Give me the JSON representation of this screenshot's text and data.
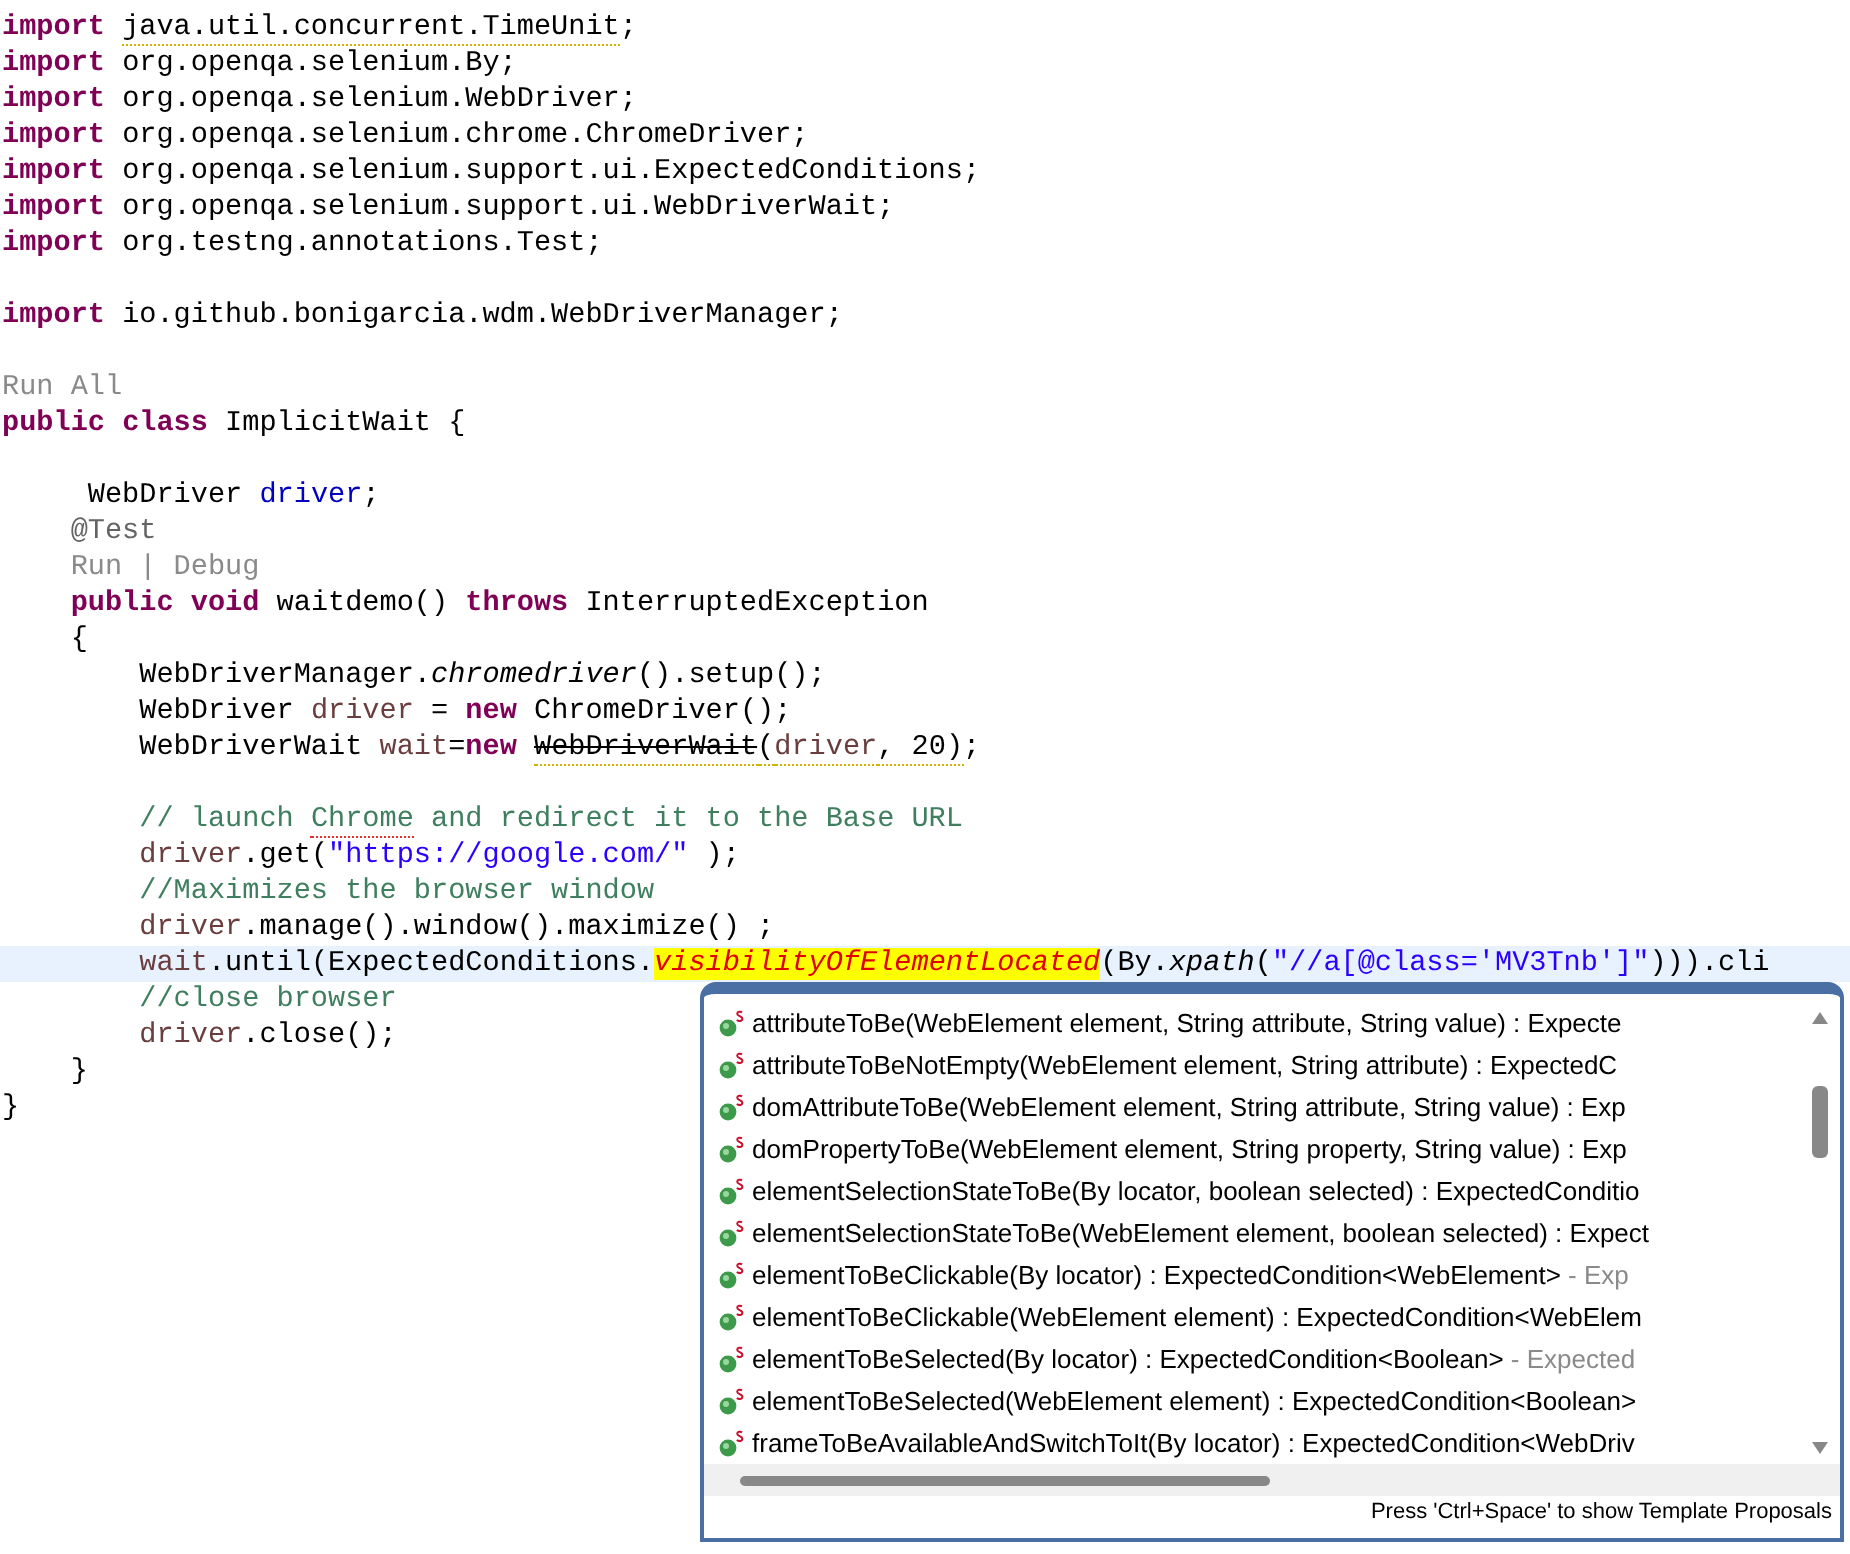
{
  "editor": {
    "lines": [
      {
        "current": false,
        "tokens": [
          {
            "t": "import ",
            "kind": "kw"
          },
          {
            "t": "java.util.concurrent.TimeUnit",
            "kind": "plain",
            "warning": true
          },
          {
            "t": ";",
            "kind": "plain"
          }
        ]
      },
      {
        "current": false,
        "tokens": [
          {
            "t": "import ",
            "kind": "kw"
          },
          {
            "t": "org.openqa.selenium.By;",
            "kind": "plain"
          }
        ]
      },
      {
        "current": false,
        "tokens": [
          {
            "t": "import ",
            "kind": "kw"
          },
          {
            "t": "org.openqa.selenium.WebDriver;",
            "kind": "plain"
          }
        ]
      },
      {
        "current": false,
        "tokens": [
          {
            "t": "import ",
            "kind": "kw"
          },
          {
            "t": "org.openqa.selenium.chrome.ChromeDriver;",
            "kind": "plain"
          }
        ]
      },
      {
        "current": false,
        "tokens": [
          {
            "t": "import ",
            "kind": "kw"
          },
          {
            "t": "org.openqa.selenium.support.ui.ExpectedConditions;",
            "kind": "plain"
          }
        ]
      },
      {
        "current": false,
        "tokens": [
          {
            "t": "import ",
            "kind": "kw"
          },
          {
            "t": "org.openqa.selenium.support.ui.WebDriverWait;",
            "kind": "plain"
          }
        ]
      },
      {
        "current": false,
        "tokens": [
          {
            "t": "import ",
            "kind": "kw"
          },
          {
            "t": "org.testng.annotations.Test;",
            "kind": "plain"
          }
        ]
      },
      {
        "current": false
      },
      {
        "current": false,
        "tokens": [
          {
            "t": "import ",
            "kind": "kw"
          },
          {
            "t": "io.github.bonigarcia.wdm.WebDriverManager;",
            "kind": "plain"
          }
        ]
      },
      {
        "current": false
      },
      {
        "current": false,
        "tokens": [
          {
            "t": "Run All",
            "kind": "lens"
          }
        ]
      },
      {
        "current": false,
        "tokens": [
          {
            "t": "public ",
            "kind": "kw"
          },
          {
            "t": "class ",
            "kind": "kw"
          },
          {
            "t": "ImplicitWait {",
            "kind": "plain"
          }
        ]
      },
      {
        "current": false
      },
      {
        "current": false,
        "tokens": [
          {
            "t": "     WebDriver ",
            "kind": "plain"
          },
          {
            "t": "driver",
            "kind": "field"
          },
          {
            "t": ";",
            "kind": "plain"
          }
        ]
      },
      {
        "current": false,
        "tokens": [
          {
            "t": "    @Test",
            "kind": "annotation"
          }
        ]
      },
      {
        "current": false,
        "tokens": [
          {
            "t": "    Run | Debug",
            "kind": "lens"
          }
        ]
      },
      {
        "current": false,
        "tokens": [
          {
            "t": "    public ",
            "kind": "kw"
          },
          {
            "t": "void ",
            "kind": "kw"
          },
          {
            "t": "waitdemo() ",
            "kind": "plain"
          },
          {
            "t": "throws ",
            "kind": "kw"
          },
          {
            "t": "InterruptedException",
            "kind": "plain"
          }
        ]
      },
      {
        "current": false,
        "tokens": [
          {
            "t": "    {",
            "kind": "plain"
          }
        ]
      },
      {
        "current": false,
        "tokens": [
          {
            "t": "        WebDriverManager.",
            "kind": "plain"
          },
          {
            "t": "chromedriver",
            "kind": "italic"
          },
          {
            "t": "().setup();",
            "kind": "plain"
          }
        ]
      },
      {
        "current": false,
        "tokens": [
          {
            "t": "        WebDriver ",
            "kind": "plain"
          },
          {
            "t": "driver",
            "kind": "local"
          },
          {
            "t": " = ",
            "kind": "plain"
          },
          {
            "t": "new ",
            "kind": "kw"
          },
          {
            "t": "ChromeDriver();",
            "kind": "plain"
          }
        ]
      },
      {
        "current": false,
        "tokens": [
          {
            "t": "        WebDriverWait ",
            "kind": "plain"
          },
          {
            "t": "wait",
            "kind": "local"
          },
          {
            "t": "=",
            "kind": "plain"
          },
          {
            "t": "new ",
            "kind": "kw"
          },
          {
            "t": "WebDriverWait",
            "kind": "deprecated",
            "warning": true
          },
          {
            "t": "(",
            "kind": "plain",
            "warning": true
          },
          {
            "t": "driver",
            "kind": "local",
            "warning": true
          },
          {
            "t": ", 20)",
            "kind": "plain",
            "warning": true
          },
          {
            "t": ";",
            "kind": "plain"
          }
        ]
      },
      {
        "current": false
      },
      {
        "current": false,
        "tokens": [
          {
            "t": "        // launch ",
            "kind": "comment"
          },
          {
            "t": "Chrome",
            "kind": "comment",
            "misspelled": true
          },
          {
            "t": " and redirect it to the Base URL",
            "kind": "comment"
          }
        ]
      },
      {
        "current": false,
        "tokens": [
          {
            "t": "        driver",
            "kind": "local"
          },
          {
            "t": ".get(",
            "kind": "plain"
          },
          {
            "t": "\"https://google.com/\"",
            "kind": "string"
          },
          {
            "t": " );",
            "kind": "plain"
          }
        ]
      },
      {
        "current": false,
        "tokens": [
          {
            "t": "        //Maximizes the browser window",
            "kind": "comment"
          }
        ]
      },
      {
        "current": false,
        "tokens": [
          {
            "t": "        driver",
            "kind": "local"
          },
          {
            "t": ".manage().window().maximize() ;",
            "kind": "plain"
          }
        ]
      },
      {
        "current": true,
        "tokens": [
          {
            "t": "        wait",
            "kind": "local"
          },
          {
            "t": ".until(ExpectedConditions.",
            "kind": "plain"
          },
          {
            "t": "visibilityOfElementLocated",
            "kind": "highlight"
          },
          {
            "t": "(By.",
            "kind": "plain"
          },
          {
            "t": "xpath",
            "kind": "italic"
          },
          {
            "t": "(",
            "kind": "plain"
          },
          {
            "t": "\"//a[@class='MV3Tnb']\"",
            "kind": "string"
          },
          {
            "t": "))).cli",
            "kind": "plain"
          }
        ]
      },
      {
        "current": false,
        "tokens": [
          {
            "t": "        //close browser",
            "kind": "comment"
          }
        ]
      },
      {
        "current": false,
        "tokens": [
          {
            "t": "        driver",
            "kind": "local"
          },
          {
            "t": ".close();",
            "kind": "plain"
          }
        ]
      },
      {
        "current": false,
        "tokens": [
          {
            "t": "    }",
            "kind": "plain"
          }
        ]
      },
      {
        "current": false,
        "tokens": [
          {
            "t": "}",
            "kind": "plain"
          }
        ]
      }
    ]
  },
  "completion": {
    "items": [
      {
        "text": "attributeToBe(WebElement element, String attribute, String value) : Expecte"
      },
      {
        "text": "attributeToBeNotEmpty(WebElement element, String attribute) : ExpectedC"
      },
      {
        "text": "domAttributeToBe(WebElement element, String attribute, String value) : Exp"
      },
      {
        "text": "domPropertyToBe(WebElement element, String property, String value) : Exp"
      },
      {
        "text": "elementSelectionStateToBe(By locator, boolean selected) : ExpectedConditio"
      },
      {
        "text": "elementSelectionStateToBe(WebElement element, boolean selected) : Expect"
      },
      {
        "text": "elementToBeClickable(By locator) : ExpectedCondition<WebElement>",
        "detail": " - Exp"
      },
      {
        "text": "elementToBeClickable(WebElement element) : ExpectedCondition<WebElem"
      },
      {
        "text": "elementToBeSelected(By locator) : ExpectedCondition<Boolean>",
        "detail": " - Expected"
      },
      {
        "text": "elementToBeSelected(WebElement element) : ExpectedCondition<Boolean>"
      },
      {
        "text": "frameToBeAvailableAndSwitchToIt(By locator) : ExpectedCondition<WebDriv"
      }
    ],
    "status": "Press 'Ctrl+Space' to show Template Proposals"
  }
}
